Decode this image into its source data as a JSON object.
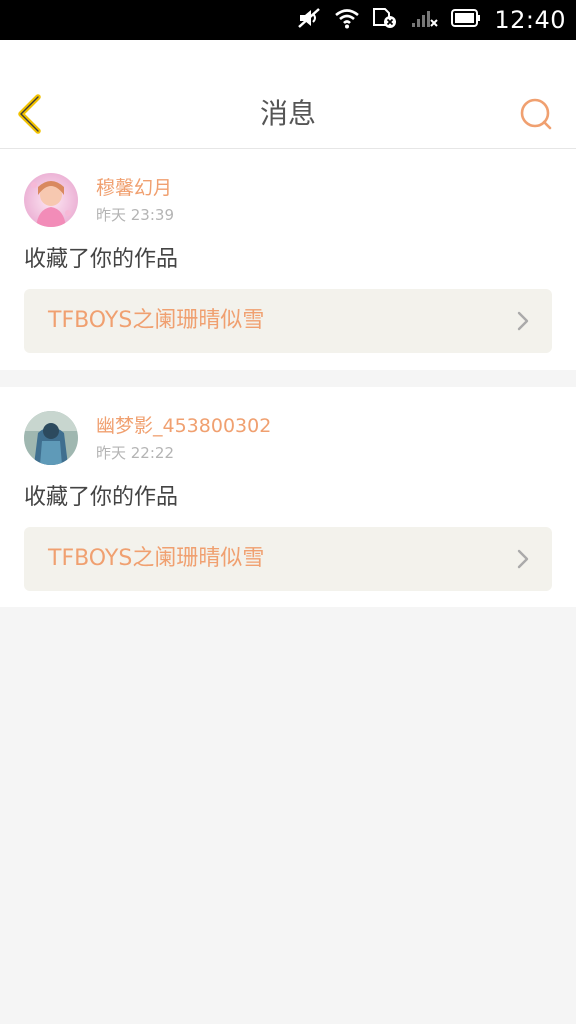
{
  "status_bar": {
    "time": "12:40",
    "icons": [
      "mute-icon",
      "wifi-icon",
      "sim-off-icon",
      "signal-icon",
      "battery-icon"
    ]
  },
  "header": {
    "title": "消息",
    "back_icon": "chevron-left-icon",
    "search_icon": "search-icon"
  },
  "colors": {
    "accent": "#f0a070",
    "back_arrow": "#f2c200",
    "card_link_bg": "#f3f2ec",
    "page_bg": "#f5f5f5"
  },
  "messages": [
    {
      "user_name": "穆馨幻月",
      "time": "昨天 23:39",
      "action": "收藏了你的作品",
      "work_title": "TFBOYS之阑珊晴似雪"
    },
    {
      "user_name": "幽梦影_453800302",
      "time": "昨天 22:22",
      "action": "收藏了你的作品",
      "work_title": "TFBOYS之阑珊晴似雪"
    }
  ]
}
